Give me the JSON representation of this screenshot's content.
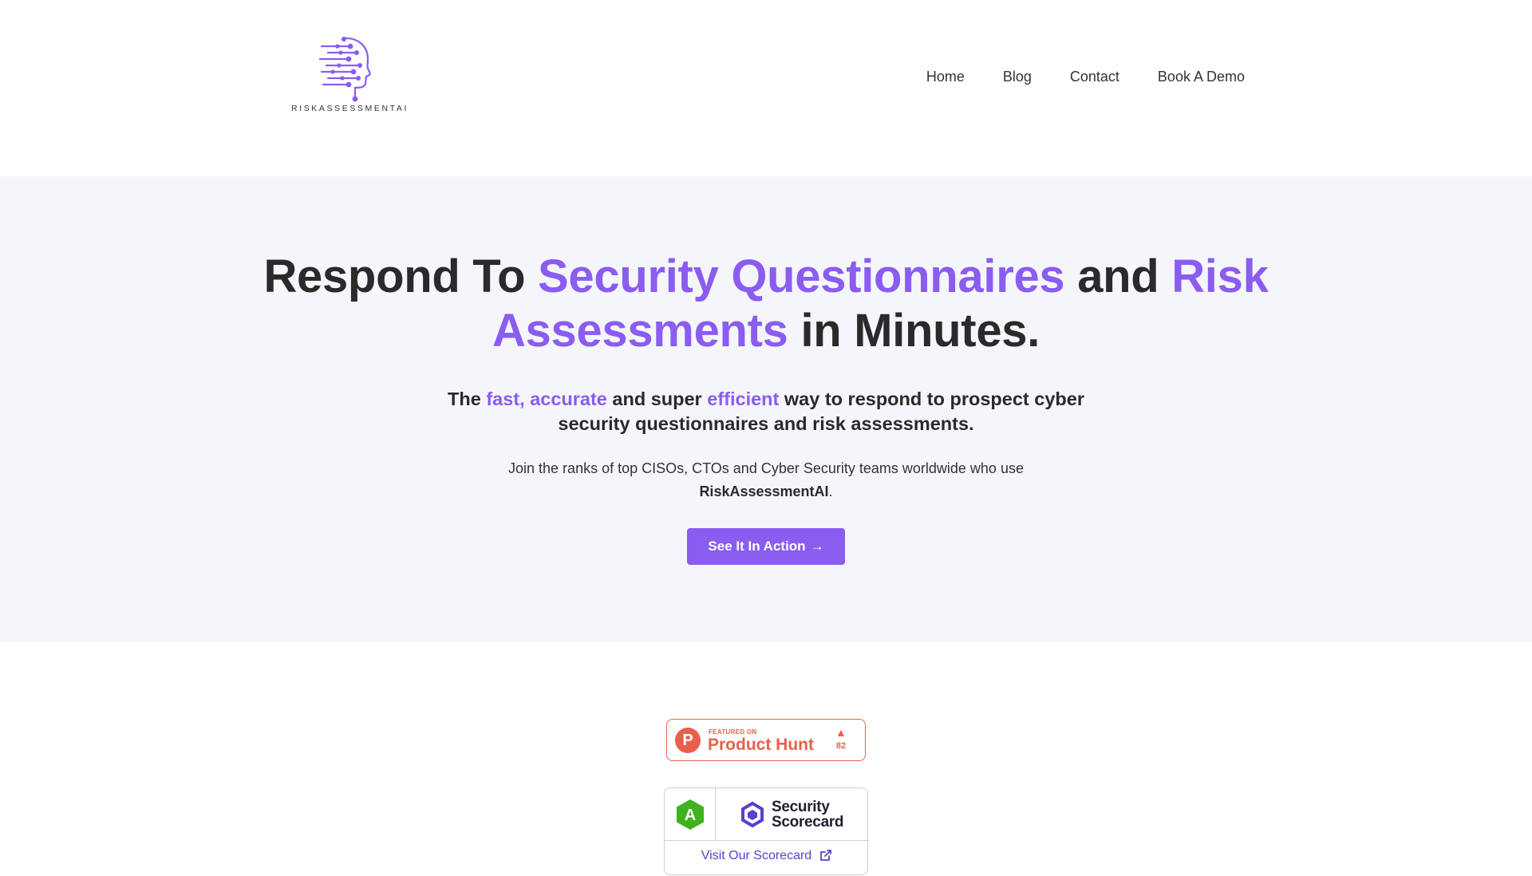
{
  "brand": {
    "logo_text": "RISKASSESSMENTAI",
    "logo_icon": "head-circuit-icon",
    "accent_color": "#8b5cf0"
  },
  "nav": {
    "items": [
      {
        "label": "Home"
      },
      {
        "label": "Blog"
      },
      {
        "label": "Contact"
      },
      {
        "label": "Book A Demo"
      }
    ]
  },
  "hero": {
    "title_parts": {
      "p1": "Respond To ",
      "a1": "Security Questionnaires",
      "p2": " and ",
      "a2": "Risk Assessments",
      "p3": " in Minutes."
    },
    "subtitle_parts": {
      "p1": "The ",
      "a1": "fast, accurate",
      "p2": " and super ",
      "a2": "efficient",
      "p3": " way to respond to prospect cyber security questionnaires and risk assessments."
    },
    "description": {
      "text": "Join the ranks of top CISOs, CTOs and Cyber Security teams worldwide who use ",
      "brand": "RiskAssessmentAI",
      "end": "."
    },
    "cta_label": "See It In Action",
    "cta_arrow": "→"
  },
  "product_hunt": {
    "featured_text": "FEATURED ON",
    "name": "Product Hunt",
    "letter": "P",
    "upvote_icon": "triangle-up-icon",
    "upvotes": "82",
    "color": "#e8604c"
  },
  "scorecard": {
    "grade": "A",
    "grade_color": "#3fb21f",
    "name_line1": "Security",
    "name_line2": "Scorecard",
    "visit_label": "Visit Our Scorecard",
    "visit_icon": "external-link-icon",
    "link_color": "#5b3fd0"
  }
}
